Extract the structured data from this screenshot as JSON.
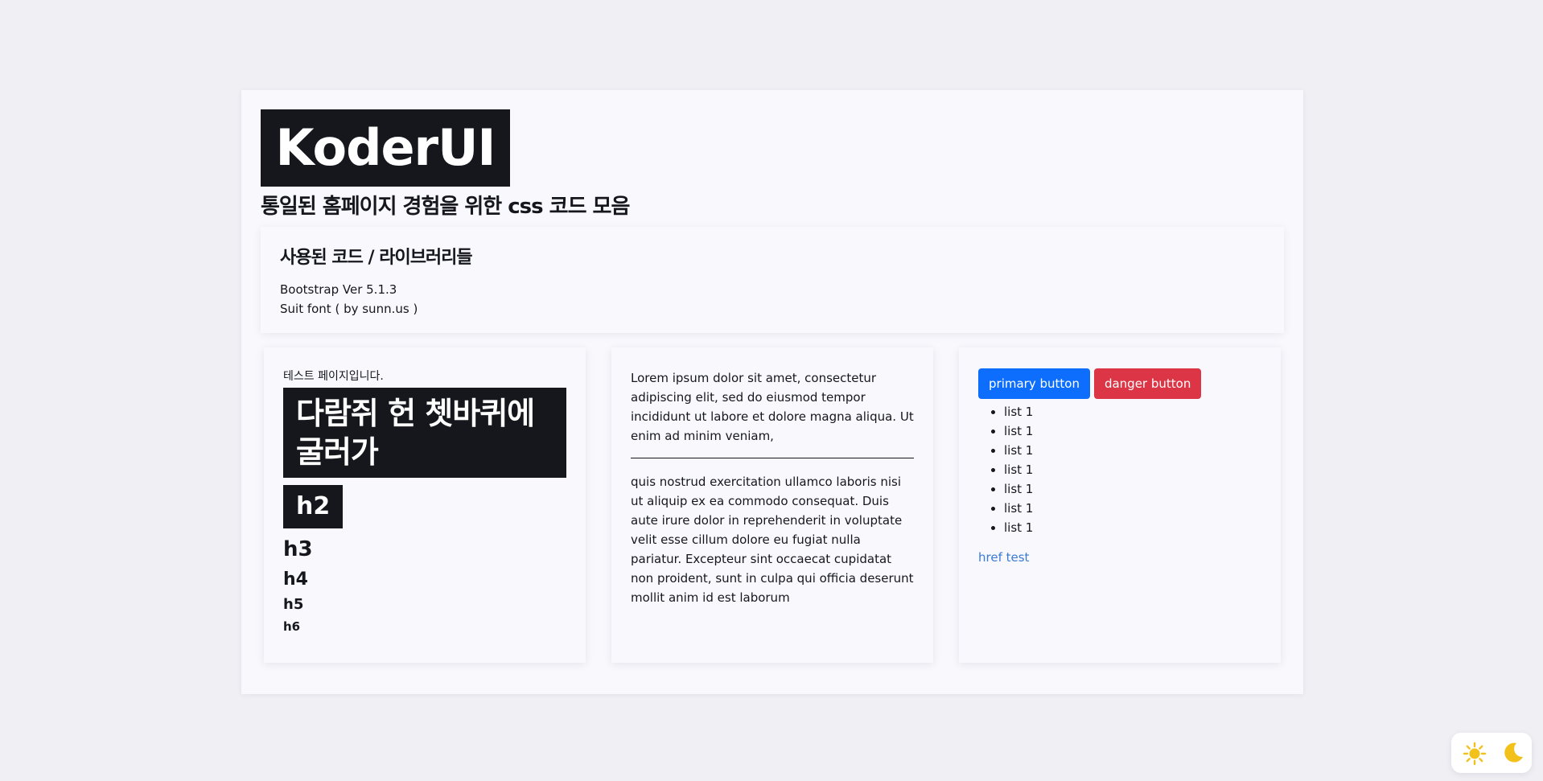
{
  "brand": {
    "logo": "KoderUI",
    "subtitle": "통일된 홈페이지 경험을 위한 css 코드 모음"
  },
  "info": {
    "title": "사용된 코드 / 라이브러리들",
    "lines": [
      "Bootstrap Ver 5.1.3",
      "Suit font ( by sunn.us )"
    ]
  },
  "typography": {
    "intro": "테스트 페이지입니다.",
    "h1": "다람쥐 헌 쳇바퀴에 굴러가",
    "h2": "h2",
    "h3": "h3",
    "h4": "h4",
    "h5": "h5",
    "h6": "h6"
  },
  "text_card": {
    "para1": "Lorem ipsum dolor sit amet, consectetur adipiscing elit, sed do eiusmod tempor incididunt ut labore et dolore magna aliqua. Ut enim ad minim veniam,",
    "para2": "quis nostrud exercitation ullamco laboris nisi ut aliquip ex ea commodo consequat. Duis aute irure dolor in reprehenderit in voluptate velit esse cillum dolore eu fugiat nulla pariatur. Excepteur sint occaecat cupidatat non proident, sunt in culpa qui officia deserunt mollit anim id est laborum"
  },
  "components": {
    "primary_button": "primary button",
    "danger_button": "danger button",
    "list": [
      "list 1",
      "list 1",
      "list 1",
      "list 1",
      "list 1",
      "list 1",
      "list 1"
    ],
    "link": "href test"
  },
  "theme_toggle": {
    "icons": [
      "sun-icon",
      "moon-icon"
    ],
    "icon_color": "#f2c21b"
  },
  "colors": {
    "background": "#efeff4",
    "surface": "#f8f8fd",
    "dark": "#16171d",
    "primary": "#0d6efd",
    "danger": "#dc3545",
    "link": "#3a7bd5"
  }
}
